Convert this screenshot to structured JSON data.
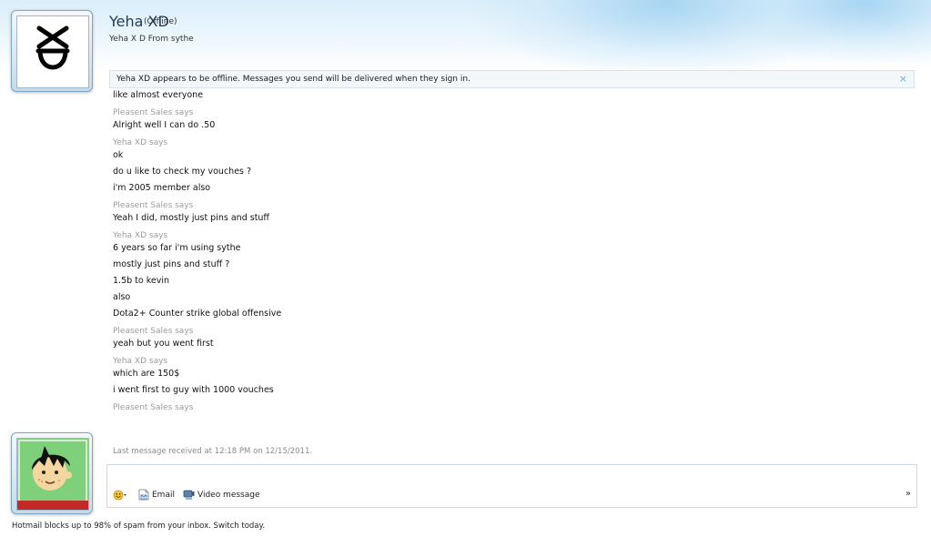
{
  "contact": {
    "name": "Yeha XD",
    "status": "(Offline)",
    "personal_message": "Yeha X D From sythe"
  },
  "notice": {
    "text": "Yeha XD appears to be offline. Messages you send will be delivered when they sign in.",
    "close_symbol": "×"
  },
  "conversation": [
    {
      "sender": "",
      "lines": [
        "like almost everyone"
      ]
    },
    {
      "sender": "Pleasent Sales says",
      "lines": [
        "Alright well I can do .50"
      ]
    },
    {
      "sender": "Yeha XD says",
      "lines": [
        "ok",
        "do u like to check my vouches ?",
        "i'm 2005 member also"
      ]
    },
    {
      "sender": "Pleasent Sales says",
      "lines": [
        "Yeah I did, mostly just pins and stuff"
      ]
    },
    {
      "sender": "Yeha XD says",
      "lines": [
        "6 years so far i'm using sythe",
        "mostly just pins and stuff ?",
        "1.5b to kevin",
        "also",
        "Dota2+ Counter strike global offensive"
      ]
    },
    {
      "sender": "Pleasent Sales says",
      "lines": [
        "yeah but you went first"
      ]
    },
    {
      "sender": "Yeha XD says",
      "lines": [
        "which are 150$",
        "i went first to guy with 1000 vouches"
      ]
    },
    {
      "sender": "Pleasent Sales says",
      "lines": []
    }
  ],
  "last_message": "Last message received at 12:18 PM on 12/15/2011.",
  "compose": {
    "email_label": "Email",
    "video_label": "Video message",
    "more_symbol": "»"
  },
  "footer": {
    "text": "Hotmail blocks up to 98% of spam from your inbox. Switch today."
  },
  "colors": {
    "accent": "#1f3a55",
    "sender_gray": "#9c9c9c",
    "banner_blue": "#dbeefa",
    "avatar_green": "#7ed07a"
  }
}
